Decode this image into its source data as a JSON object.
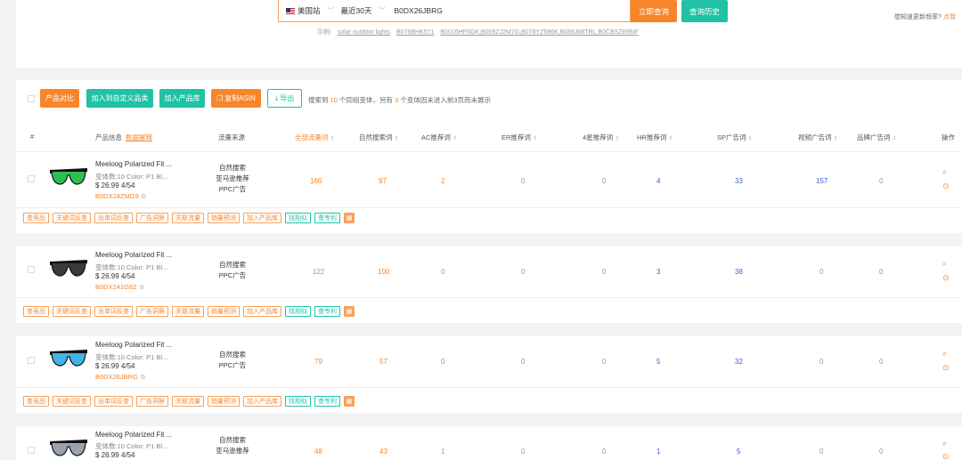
{
  "search": {
    "marketplace": "美国站",
    "period": "最近30天",
    "asin_value": "B0DX26JBRG",
    "search_button": "立即查询",
    "history_button": "查询历史",
    "update_hint": "想知道更新频率?",
    "update_link": "点我",
    "examples_label": "示例:",
    "examples": [
      "solar outdoor lights",
      "B075BHK571",
      "B0016HF5GK,B009ZJ2M7G,B078YZ586K,B088J68TRL,B0CBSZR9NF"
    ]
  },
  "toolbar": {
    "compare": "产品对比",
    "add_custom_category": "加入到自定义品类",
    "add_product_lib": "加入产品库",
    "copy_asin": "复制ASIN",
    "export": "导出",
    "summary_prefix": "搜索到",
    "summary_count1": "10",
    "summary_mid": "个同组变体，另有",
    "summary_count2": "3",
    "summary_suffix": "个变体因未进入前3页而未展示"
  },
  "columns": {
    "idx": "#",
    "info": "产品信息",
    "info_link": "数据解释",
    "source": "流量来源",
    "all": "全部流量词",
    "natural": "自然搜索词",
    "ac": "AC推荐词",
    "er": "ER推荐词",
    "star4": "4星推荐词",
    "hr": "HR推荐词",
    "sp": "SP广告词",
    "video": "视频广告词",
    "brand": "品牌广告词",
    "ops": "操作"
  },
  "tags": [
    "查竞品",
    "关键词反查",
    "出单词反查",
    "广告洞察",
    "关联流量",
    "销量预测",
    "加入产品库",
    "找相似",
    "查专利"
  ],
  "rows": [
    {
      "title": "Meeloog Polarized Fit ...",
      "meta": "变体数:10   Color: P1 Bl...",
      "price": "$ 26.99   4/54",
      "asin": "B0DX24ZMG9",
      "sources": [
        "自然搜索",
        "亚马逊推荐",
        "PPC广告"
      ],
      "all": "186",
      "natural": "97",
      "ac": "2",
      "er": "0",
      "star4": "0",
      "hr": "4",
      "sp": "33",
      "video": "157",
      "brand": "0",
      "lens": "#2fbf4f"
    },
    {
      "title": "Meeloog Polarized Fit ...",
      "meta": "变体数:10   Color: P1 Bl...",
      "price": "$ 26.99   4/54",
      "asin": "B0DX241G8Z",
      "sources": [
        "自然搜索",
        "PPC广告"
      ],
      "all": "122",
      "natural": "100",
      "ac": "0",
      "er": "0",
      "star4": "0",
      "hr": "3",
      "sp": "38",
      "video": "0",
      "brand": "0",
      "lens": "#3a3a3a"
    },
    {
      "title": "Meeloog Polarized Fit ...",
      "meta": "变体数:10   Color: P1 Bl...",
      "price": "$ 26.99   4/54",
      "asin": "B0DX26JBRG",
      "sources": [
        "自然搜索",
        "PPC广告"
      ],
      "all": "79",
      "natural": "57",
      "ac": "0",
      "er": "0",
      "star4": "0",
      "hr": "5",
      "sp": "32",
      "video": "0",
      "brand": "0",
      "lens": "#3fb6e8"
    },
    {
      "title": "Meeloog Polarized Fit ...",
      "meta": "变体数:10   Color: P1 Bl...",
      "price": "$ 26.99   4/54",
      "asin": "",
      "sources": [
        "自然搜索",
        "亚马逊推荐"
      ],
      "all": "48",
      "natural": "43",
      "ac": "1",
      "er": "0",
      "star4": "0",
      "hr": "1",
      "sp": "5",
      "video": "0",
      "brand": "0",
      "lens": "#9aa3ad"
    }
  ]
}
